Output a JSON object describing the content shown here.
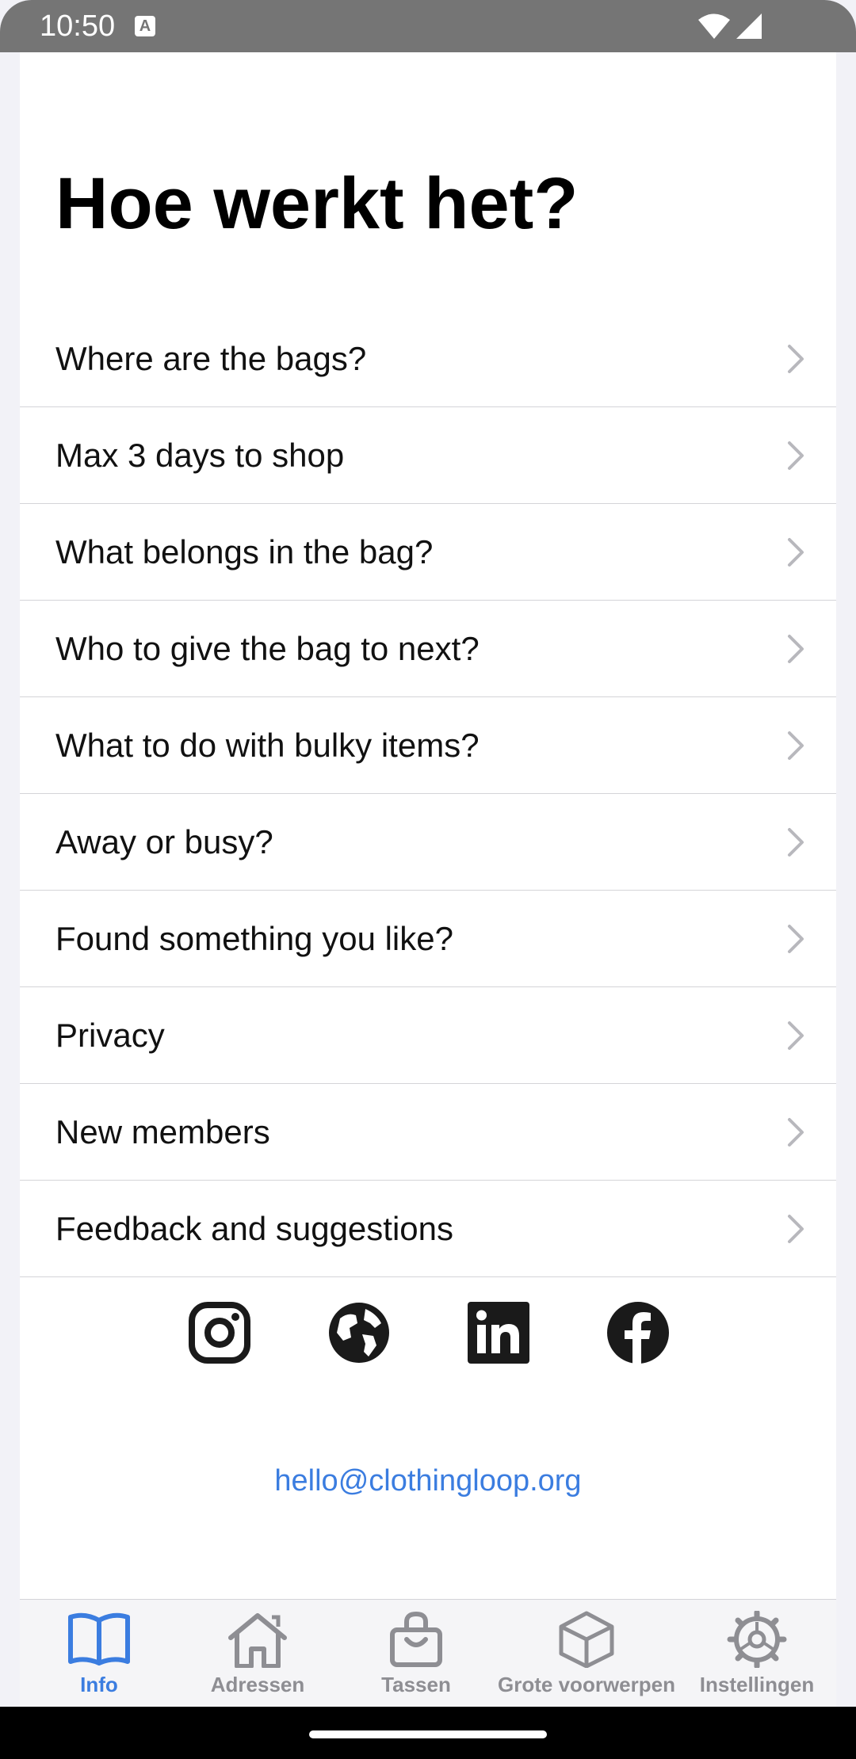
{
  "status_bar": {
    "time": "10:50",
    "icons": [
      "notification-a-icon",
      "wifi-icon",
      "signal-icon"
    ]
  },
  "page": {
    "title": "Hoe werkt het?"
  },
  "faq": {
    "items": [
      {
        "label": "Where are the bags?"
      },
      {
        "label": "Max 3 days to shop"
      },
      {
        "label": "What belongs in the bag?"
      },
      {
        "label": "Who to give the bag to next?"
      },
      {
        "label": "What to do with bulky items?"
      },
      {
        "label": "Away or busy?"
      },
      {
        "label": "Found something you like?"
      },
      {
        "label": "Privacy"
      },
      {
        "label": "New members"
      },
      {
        "label": "Feedback and suggestions"
      }
    ]
  },
  "social": {
    "icons": [
      "instagram-icon",
      "globe-icon",
      "linkedin-icon",
      "facebook-icon"
    ],
    "email": "hello@clothingloop.org"
  },
  "tabs": [
    {
      "label": "Info",
      "icon": "book-icon",
      "active": true
    },
    {
      "label": "Adressen",
      "icon": "home-icon",
      "active": false
    },
    {
      "label": "Tassen",
      "icon": "bag-icon",
      "active": false
    },
    {
      "label": "Grote voorwerpen",
      "icon": "cube-icon",
      "active": false
    },
    {
      "label": "Instellingen",
      "icon": "gear-icon",
      "active": false
    }
  ],
  "colors": {
    "accent": "#3b7de0",
    "status_bar": "#757575",
    "inactive_tab": "#8e8e93"
  }
}
